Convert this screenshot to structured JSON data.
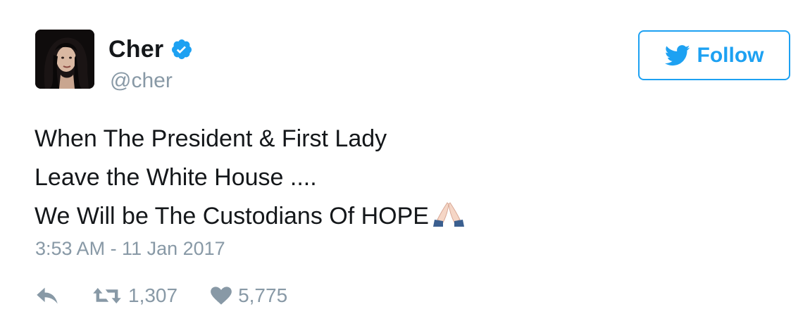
{
  "tweet": {
    "author": {
      "display_name": "Cher",
      "handle": "@cher",
      "verified": true,
      "avatar_icon": "profile-photo"
    },
    "follow_button": {
      "label": "Follow",
      "icon": "twitter-bird-icon"
    },
    "text_lines": [
      "When The President & First Lady",
      "Leave the White House ....",
      "We Will be The Custodians Of HOPE"
    ],
    "emoji": "folded-hands-emoji",
    "timestamp": "3:53 AM - 11 Jan 2017",
    "actions": {
      "reply_icon": "reply-icon",
      "retweet_icon": "retweet-icon",
      "retweet_count": "1,307",
      "like_icon": "heart-icon",
      "like_count": "5,775"
    }
  },
  "colors": {
    "accent": "#1da1f2",
    "text": "#14171a",
    "muted": "#8899a6"
  }
}
